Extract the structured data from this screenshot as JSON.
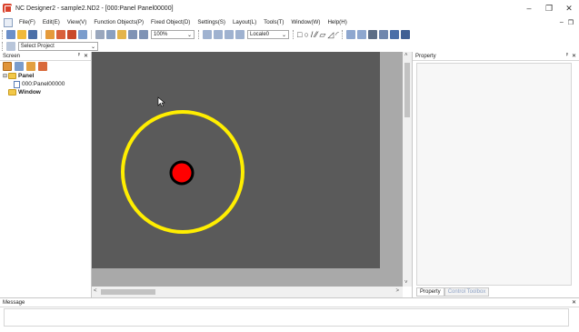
{
  "window": {
    "title": "NC Designer2 - sample2.ND2 - [000:Panel Panel00000]",
    "minimize": "–",
    "maximize": "❐",
    "close": "✕"
  },
  "menu": {
    "items": [
      "File(F)",
      "Edit(E)",
      "View(V)",
      "Function Objects(P)",
      "Fixed Object(D)",
      "Settings(S)",
      "Layout(L)",
      "Tools(T)",
      "Window(W)",
      "Help(H)"
    ],
    "mdi_min": "–",
    "mdi_restore": "❐"
  },
  "toolbar": {
    "zoom": "100%",
    "locale": "Locale0"
  },
  "toolbar2": {
    "project": "Select Project"
  },
  "screen_panel": {
    "title": "Screen",
    "pin": "ᵖ",
    "close": "✕",
    "tree": {
      "panel_label": "Panel",
      "panel_child": "000:Panel00000",
      "window_label": "Window"
    }
  },
  "canvas": {
    "background": "#5a5a5a",
    "ring_color": "#ffee00",
    "dot_color": "#ff0000"
  },
  "property_panel": {
    "title": "Property",
    "pin": "ᵖ",
    "close": "✕",
    "tabs": [
      "Property",
      "Control Toolbox"
    ]
  },
  "message_panel": {
    "title": "Message",
    "close": "✕"
  }
}
